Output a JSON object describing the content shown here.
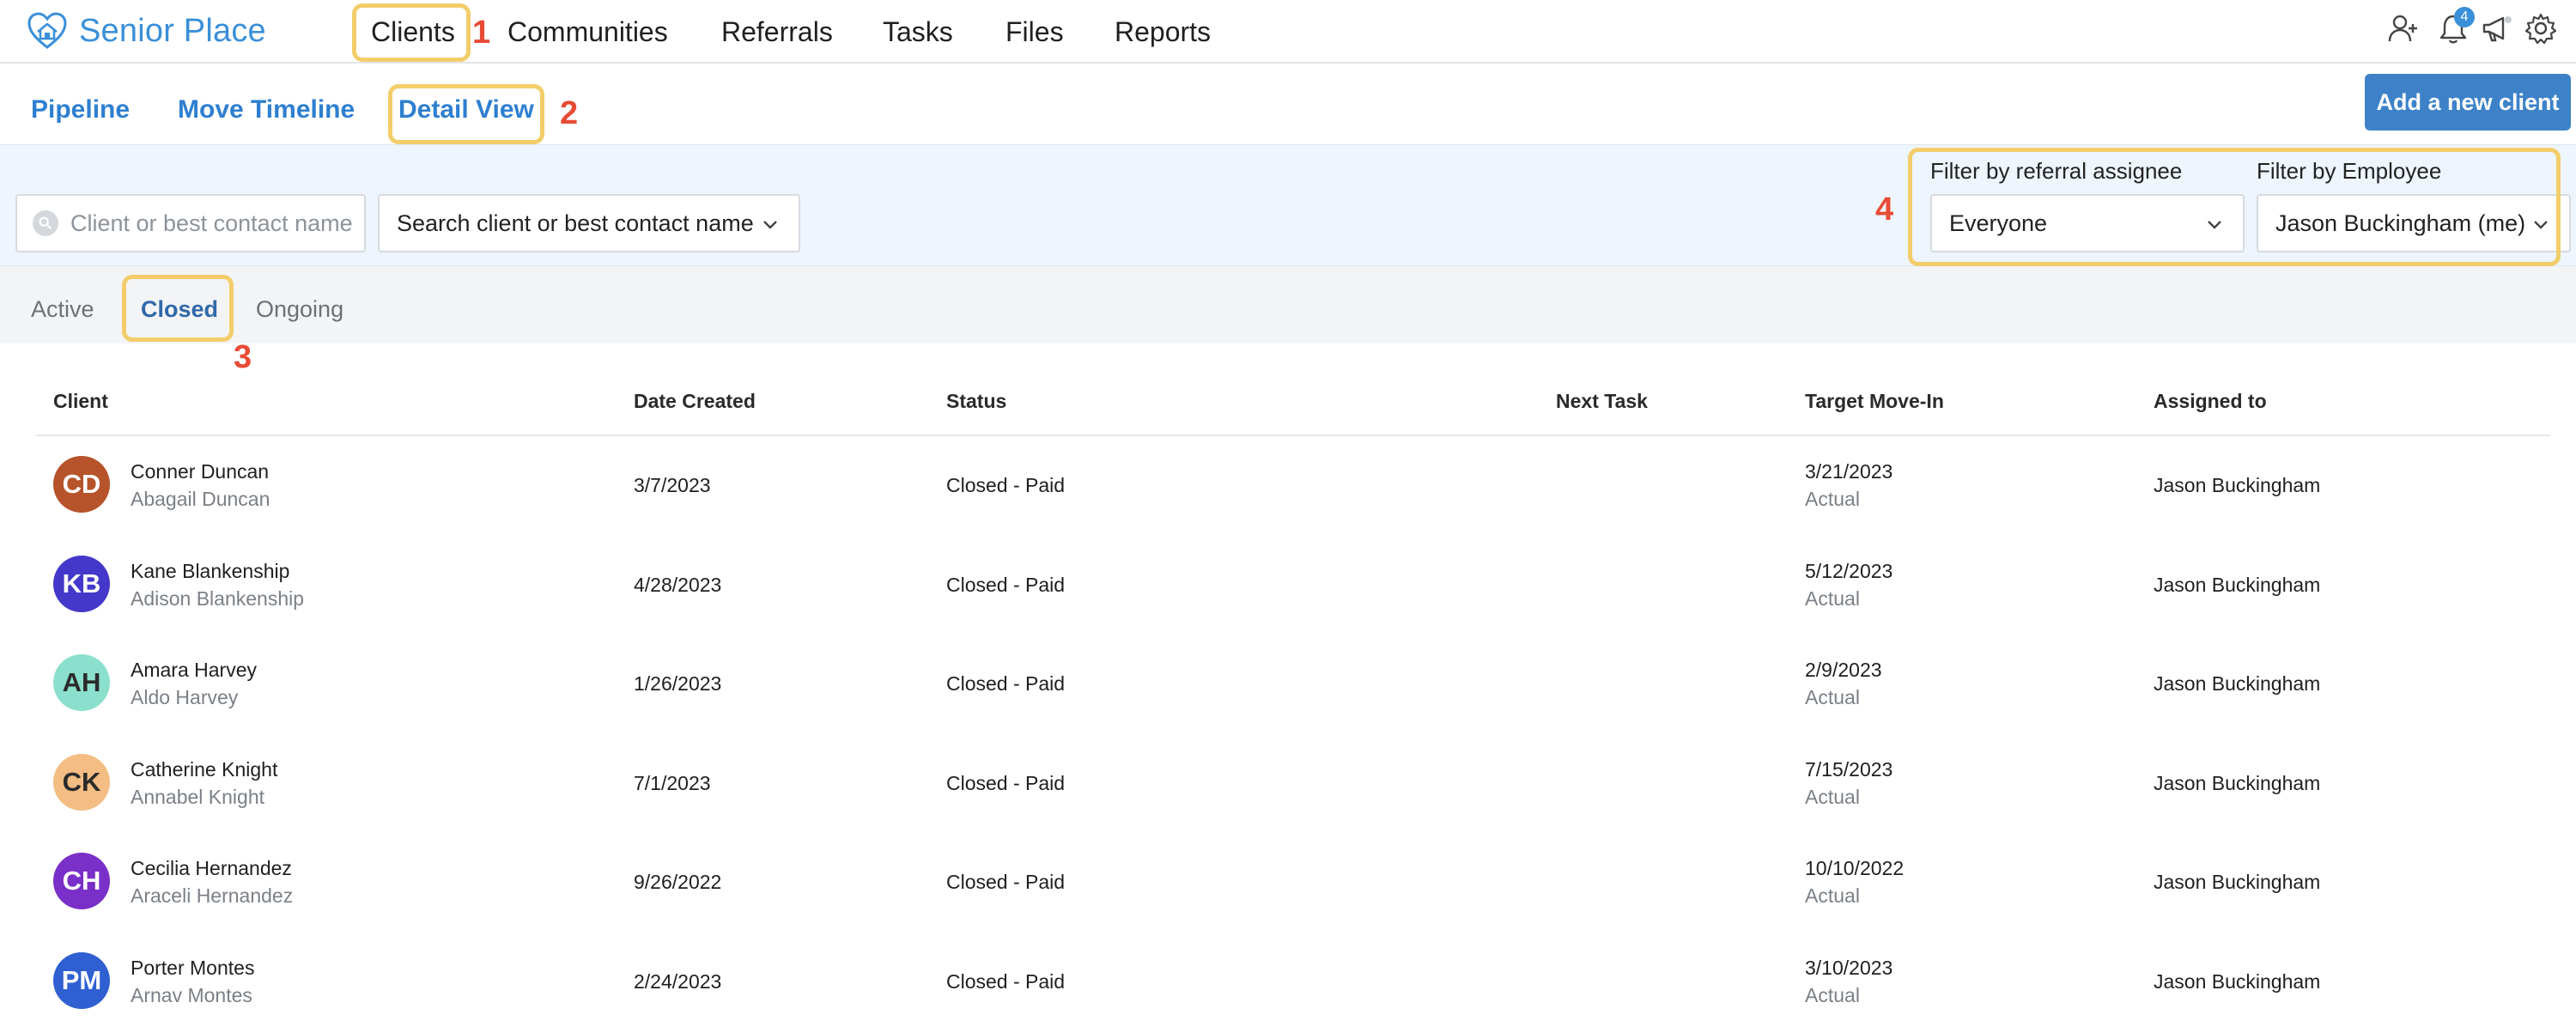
{
  "brand": {
    "name": "Senior Place",
    "logo_icon": "heart-house-logo-icon"
  },
  "nav": {
    "items": [
      "Clients",
      "Communities",
      "Referrals",
      "Tasks",
      "Files",
      "Reports"
    ],
    "icons": [
      "add-user-icon",
      "bell-icon",
      "megaphone-icon",
      "gear-icon"
    ],
    "notification_count": "4"
  },
  "subnav": {
    "items": [
      "Pipeline",
      "Move Timeline",
      "Detail View"
    ],
    "add_button": "Add a new client"
  },
  "filters": {
    "search_placeholder": "Client or best contact name",
    "client_select": "Search client or best contact name",
    "referral_label": "Filter by referral assignee",
    "referral_value": "Everyone",
    "employee_label": "Filter by Employee",
    "employee_value": "Jason Buckingham (me)"
  },
  "status_tabs": {
    "items": [
      "Active",
      "Closed",
      "Ongoing"
    ],
    "selected": "Closed"
  },
  "table": {
    "headers": [
      "Client",
      "Date Created",
      "Status",
      "Next Task",
      "Target Move-In",
      "Assigned to"
    ],
    "rows": [
      {
        "initials": "CD",
        "avatar_color": "#b6532a",
        "name": "Conner Duncan",
        "contact": "Abagail Duncan",
        "date_created": "3/7/2023",
        "status": "Closed - Paid",
        "next_task": "",
        "move_in": "3/21/2023",
        "move_in_type": "Actual",
        "assigned": "Jason Buckingham"
      },
      {
        "initials": "KB",
        "avatar_color": "#4338ca",
        "name": "Kane Blankenship",
        "contact": "Adison Blankenship",
        "date_created": "4/28/2023",
        "status": "Closed - Paid",
        "next_task": "",
        "move_in": "5/12/2023",
        "move_in_type": "Actual",
        "assigned": "Jason Buckingham"
      },
      {
        "initials": "AH",
        "avatar_color": "#8be0cd",
        "name": "Amara Harvey",
        "contact": "Aldo Harvey",
        "date_created": "1/26/2023",
        "status": "Closed - Paid",
        "next_task": "",
        "move_in": "2/9/2023",
        "move_in_type": "Actual",
        "assigned": "Jason Buckingham"
      },
      {
        "initials": "CK",
        "avatar_color": "#f3bd83",
        "name": "Catherine Knight",
        "contact": "Annabel Knight",
        "date_created": "7/1/2023",
        "status": "Closed - Paid",
        "next_task": "",
        "move_in": "7/15/2023",
        "move_in_type": "Actual",
        "assigned": "Jason Buckingham"
      },
      {
        "initials": "CH",
        "avatar_color": "#7a2fc8",
        "name": "Cecilia Hernandez",
        "contact": "Araceli Hernandez",
        "date_created": "9/26/2022",
        "status": "Closed - Paid",
        "next_task": "",
        "move_in": "10/10/2022",
        "move_in_type": "Actual",
        "assigned": "Jason Buckingham"
      },
      {
        "initials": "PM",
        "avatar_color": "#2f5fd1",
        "name": "Porter Montes",
        "contact": "Arnav Montes",
        "date_created": "2/24/2023",
        "status": "Closed - Paid",
        "next_task": "",
        "move_in": "3/10/2023",
        "move_in_type": "Actual",
        "assigned": "Jason Buckingham"
      }
    ]
  },
  "annotations": {
    "colors": {
      "highlight": "#f2cd6a",
      "number": "#e84b35"
    },
    "labels": [
      "1",
      "2",
      "3",
      "4"
    ]
  }
}
